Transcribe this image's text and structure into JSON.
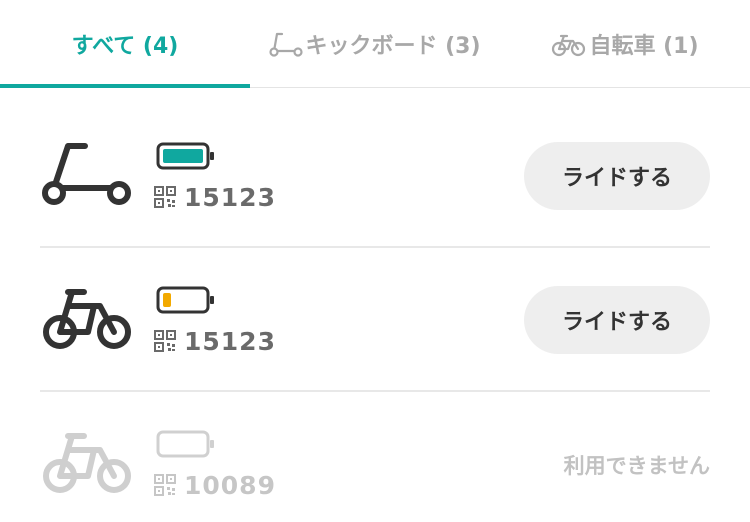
{
  "tabs": [
    {
      "label": "すべて (4)",
      "icon": "none",
      "active": true
    },
    {
      "label": "キックボード (3)",
      "icon": "kickscooter-icon",
      "active": false
    },
    {
      "label": "自転車 (1)",
      "icon": "bicycle-icon",
      "active": false
    }
  ],
  "colors": {
    "accent": "#10a89f",
    "battery_full": "#10a89f",
    "battery_low": "#f2a900",
    "text_dark": "#333333",
    "text_muted": "#a8a8a8"
  },
  "vehicles": [
    {
      "type": "kickscooter",
      "icon": "kickscooter-icon",
      "battery_level": 1.0,
      "battery_status": "full",
      "code": "15123",
      "action_label": "ライドする",
      "available": true
    },
    {
      "type": "bicycle",
      "icon": "bicycle-icon",
      "battery_level": 0.2,
      "battery_status": "low",
      "code": "15123",
      "action_label": "ライドする",
      "available": true
    },
    {
      "type": "bicycle",
      "icon": "bicycle-icon",
      "battery_level": 0,
      "battery_status": "empty",
      "code": "10089",
      "status_label": "利用できません",
      "available": false
    }
  ]
}
